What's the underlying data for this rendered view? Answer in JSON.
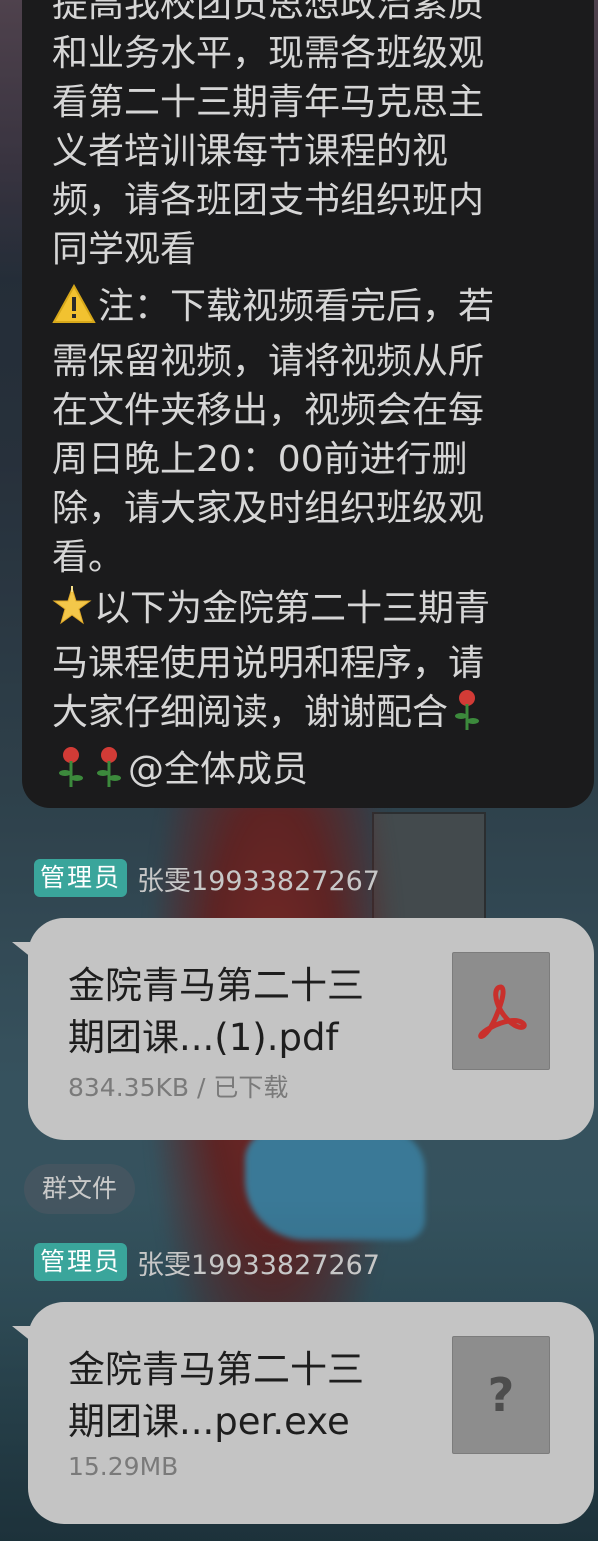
{
  "message_text": {
    "paragraph1": "提高我校团员思想政治素质\n和业务水平，现需各班级观\n看第二十三期青年马克思主\n义者培训课每节课程的视\n频，请各班团支书组织班内\n同学观看",
    "paragraph2_text": "注：下载视频看完后，若\n需保留视频，请将视频从所\n在文件夹移出，视频会在每\n周日晚上20：00前进行删\n除，请大家及时组织班级观\n看。",
    "paragraph3_text": "以下为金院第二十三期青\n马课程使用说明和程序，请\n大家仔细阅读，谢谢配合",
    "mention_all": "@全体成员",
    "icons": [
      "warning-icon",
      "star-icon",
      "rose-icon"
    ]
  },
  "messages": [
    {
      "sender_badge": "管理员",
      "sender_name": "张雯19933827267",
      "file_name": "金院青马第二十三\n期团课...(1).pdf",
      "file_meta": "834.35KB / 已下载",
      "file_icon": "pdf-icon"
    },
    {
      "sender_badge": "管理员",
      "sender_name": "张雯19933827267",
      "file_name": "金院青马第二十三\n期团课...per.exe",
      "file_meta": "15.29MB",
      "file_icon": "unknown-file-icon",
      "unknown_mark": "?"
    }
  ],
  "group_files_label": "群文件",
  "colors": {
    "bubble_dark": "#1b1b1c",
    "bubble_light": "#c4c4c4",
    "admin_badge": "#3aa59b",
    "pdf_red": "#c9302c"
  }
}
